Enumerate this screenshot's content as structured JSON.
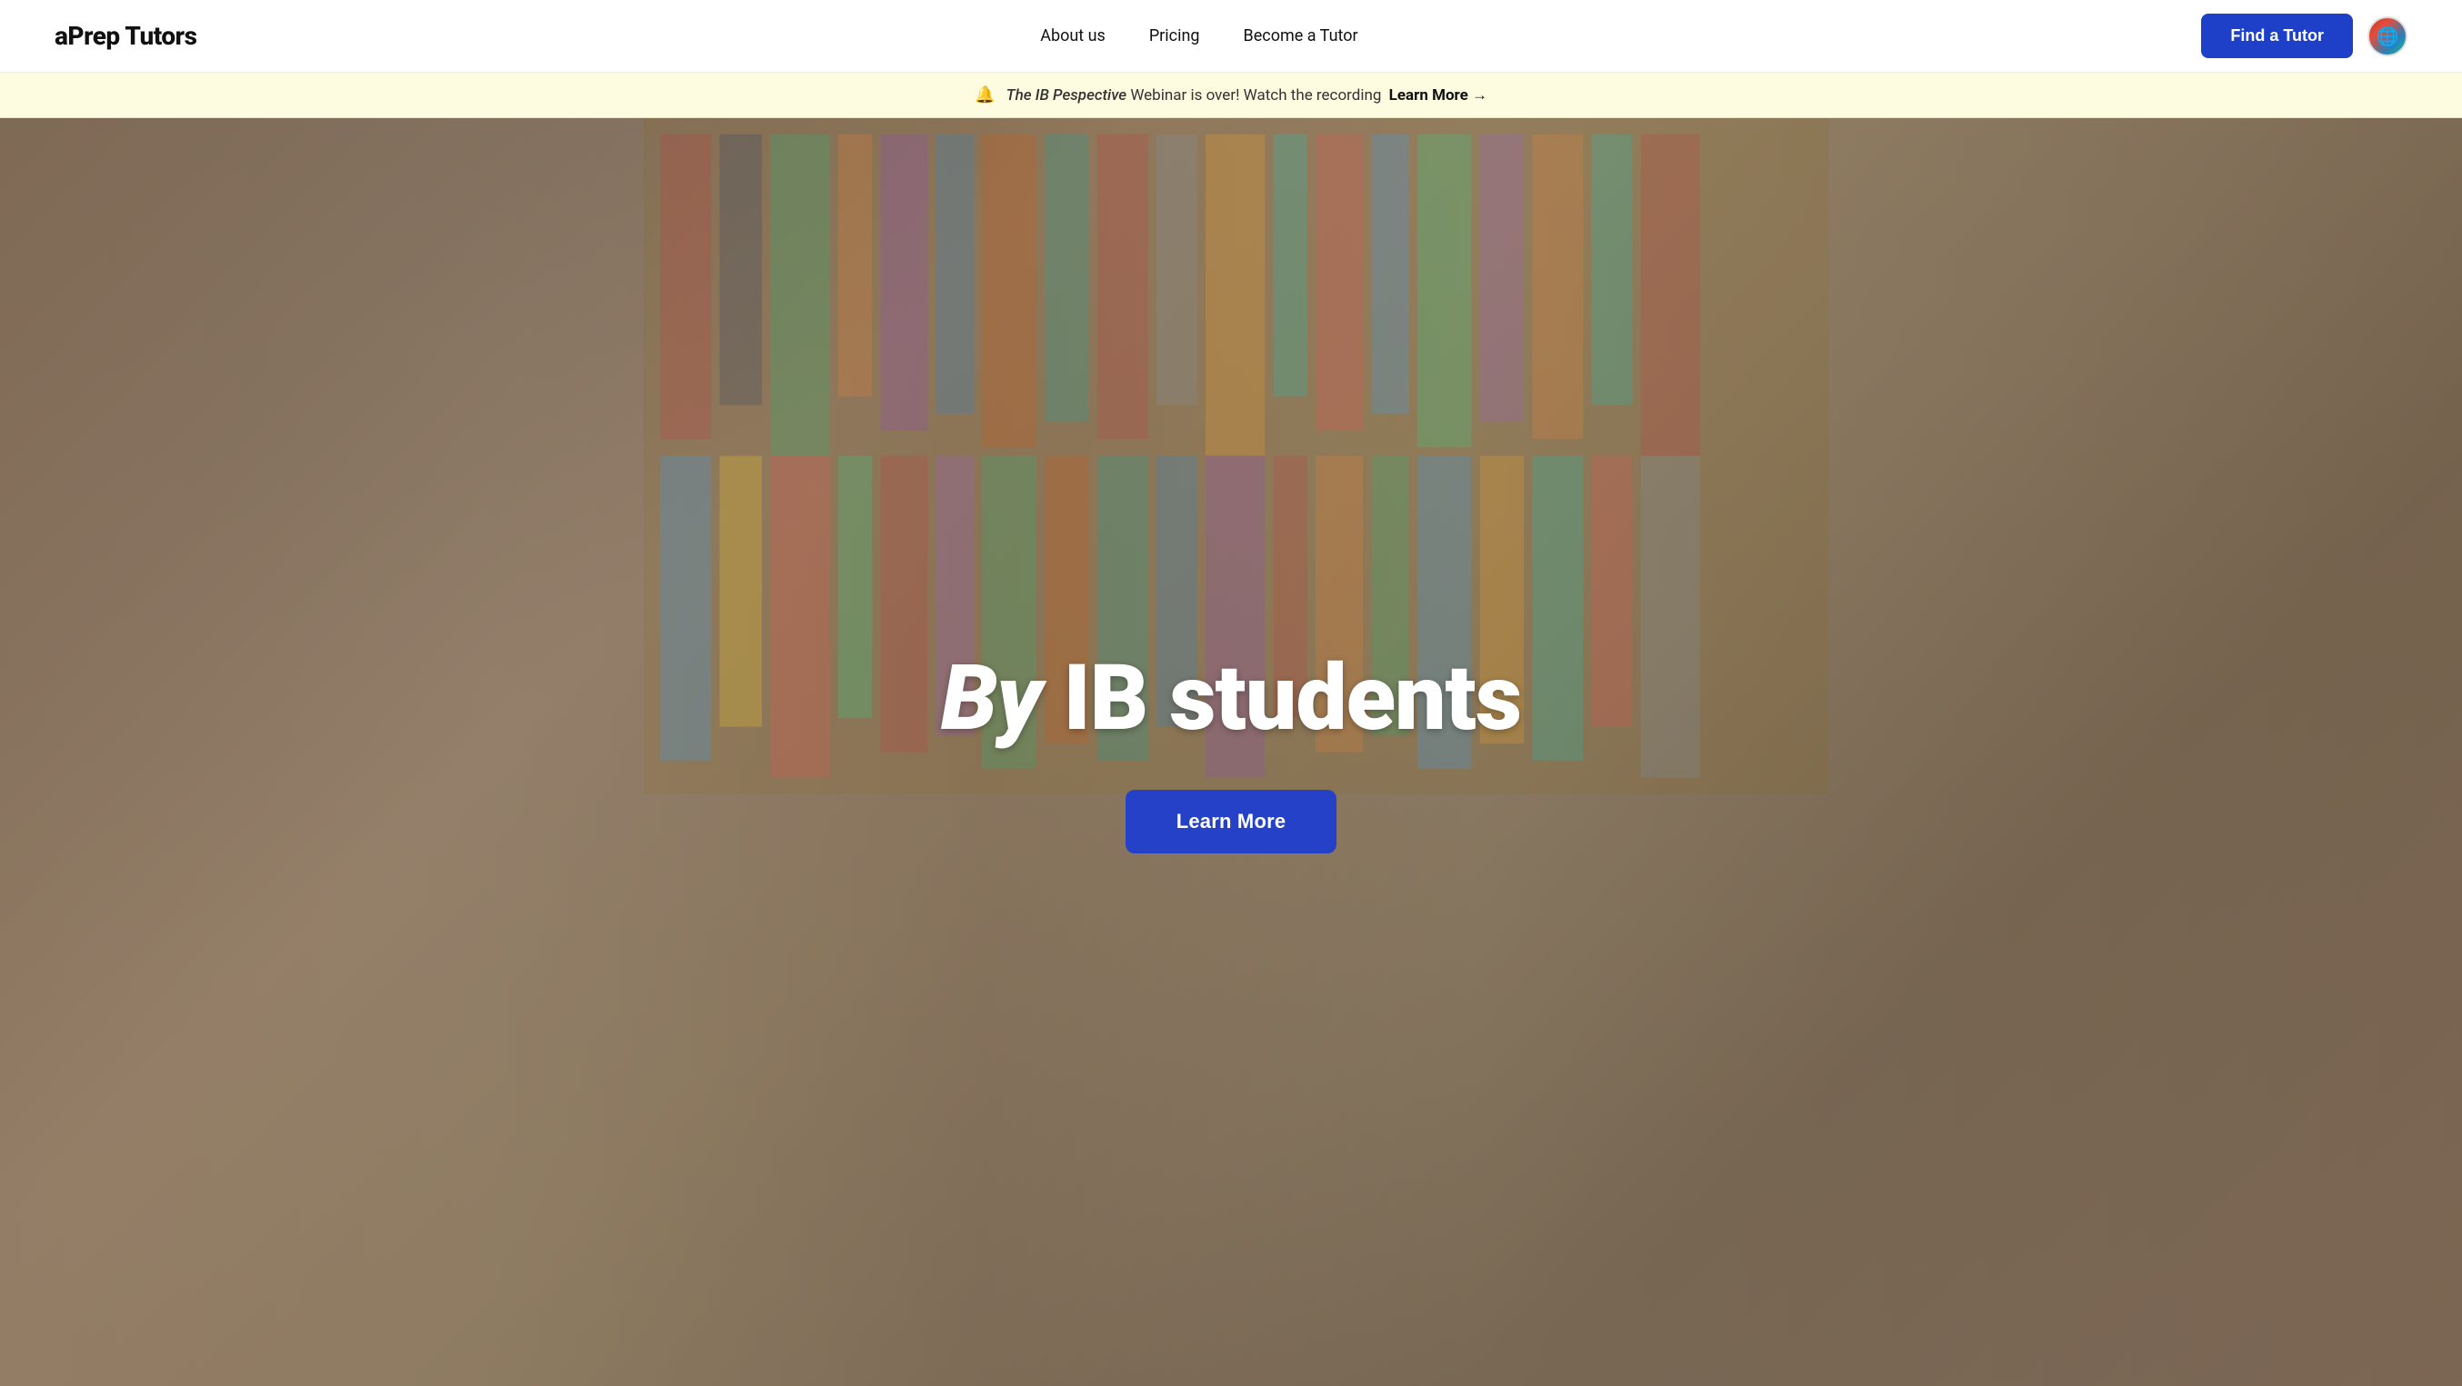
{
  "brand": {
    "logo": "aPrep Tutors"
  },
  "navbar": {
    "links": [
      {
        "label": "About us",
        "href": "#"
      },
      {
        "label": "Pricing",
        "href": "#"
      },
      {
        "label": "Become a Tutor",
        "href": "#"
      }
    ],
    "cta_button": "Find a Tutor"
  },
  "announcement": {
    "bell_icon": "🔔",
    "prefix": "",
    "italic_title": "The IB Pespective",
    "message": " Webinar is over! Watch the recording ",
    "learn_more_label": "Learn More →"
  },
  "hero": {
    "title_italic": "By",
    "title_rest": " IB students",
    "cta_button": "Learn More"
  }
}
